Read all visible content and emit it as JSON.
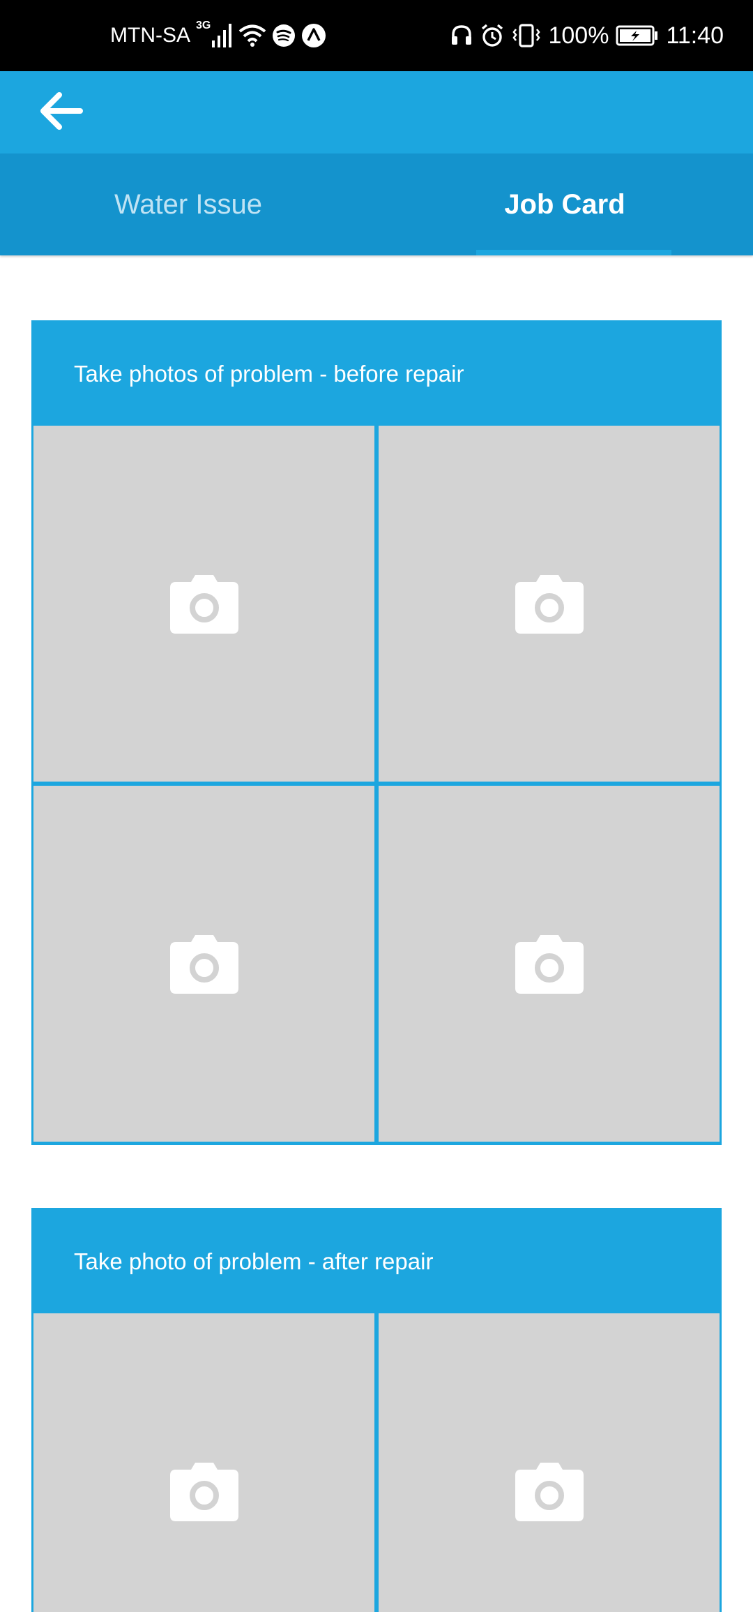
{
  "status_bar": {
    "carrier": "MTN-SA",
    "network_type": "3G",
    "battery_percent": "100%",
    "time": "11:40",
    "left_icons": [
      "signal-icon",
      "wifi-icon",
      "spotify-icon",
      "nav-app-icon"
    ],
    "right_icons": [
      "headphones-icon",
      "alarm-icon",
      "vibrate-icon",
      "battery-charging-icon"
    ]
  },
  "app_bar": {
    "back_icon": "back-arrow-icon",
    "color": "#1ca6df"
  },
  "tabs": [
    {
      "label": "Water Issue",
      "selected": false
    },
    {
      "label": "Job Card",
      "selected": true
    }
  ],
  "sections": [
    {
      "title": "Take photos of problem - before repair",
      "photo_slots": [
        "camera-icon",
        "camera-icon",
        "camera-icon",
        "camera-icon"
      ]
    },
    {
      "title": "Take photo of problem - after repair",
      "photo_slots": [
        "camera-icon",
        "camera-icon"
      ]
    }
  ],
  "colors": {
    "primary": "#1ca6df",
    "tab_bar": "#1493cd",
    "placeholder": "#d3d3d3",
    "status_bar": "#000000"
  }
}
